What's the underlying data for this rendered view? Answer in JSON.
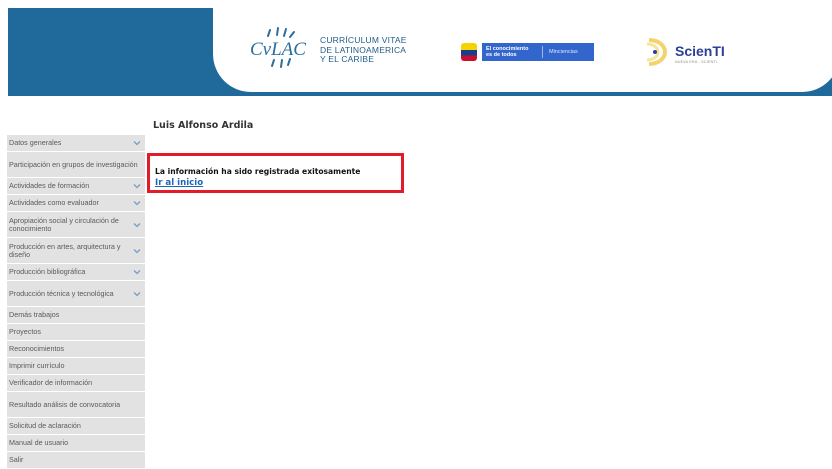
{
  "header": {
    "cvlac": {
      "brand": "CvLAC",
      "line1": "CURRÍCULUM VITAE",
      "line2": "DE LATINOAMERICA",
      "line3": "Y EL CARIBE"
    },
    "ministry": {
      "slogan_line1": "El conocimiento",
      "slogan_line2": "es de todos",
      "name": "Minciencias"
    },
    "scienti": {
      "name": "ScienTI",
      "subtitle": "NUEVA ERA - SCIENTI"
    },
    "colors": {
      "bar": "#1f6a9b",
      "accent_red": "#e21b2b",
      "link": "#1e66b8"
    }
  },
  "sidebar": {
    "items": [
      {
        "label": "Datos generales",
        "expandable": true
      },
      {
        "label": "Participación en grupos de investigación",
        "expandable": false
      },
      {
        "label": "Actividades de formación",
        "expandable": true
      },
      {
        "label": "Actividades como evaluador",
        "expandable": true
      },
      {
        "label": "Apropiación social y circulación de conocimiento",
        "expandable": true
      },
      {
        "label": "Producción en artes, arquitectura y diseño",
        "expandable": true
      },
      {
        "label": "Producción bibliográfica",
        "expandable": true
      },
      {
        "label": "Producción técnica y tecnológica",
        "expandable": true
      },
      {
        "label": "Demás trabajos",
        "expandable": false
      },
      {
        "label": "Proyectos",
        "expandable": false
      },
      {
        "label": "Reconocimientos",
        "expandable": false
      },
      {
        "label": "Imprimir currículo",
        "expandable": false
      },
      {
        "label": "Verificador de información",
        "expandable": false
      },
      {
        "label": "Resultado análisis de convocatoria",
        "expandable": false
      },
      {
        "label": "Solicitud de aclaración",
        "expandable": false
      },
      {
        "label": "Manual de usuario",
        "expandable": false
      },
      {
        "label": "Salir",
        "expandable": false
      }
    ]
  },
  "main": {
    "user_name": "Luis Alfonso Ardila",
    "success_message": "La información ha sido registrada exitosamente",
    "home_link": "Ir al inicio"
  }
}
